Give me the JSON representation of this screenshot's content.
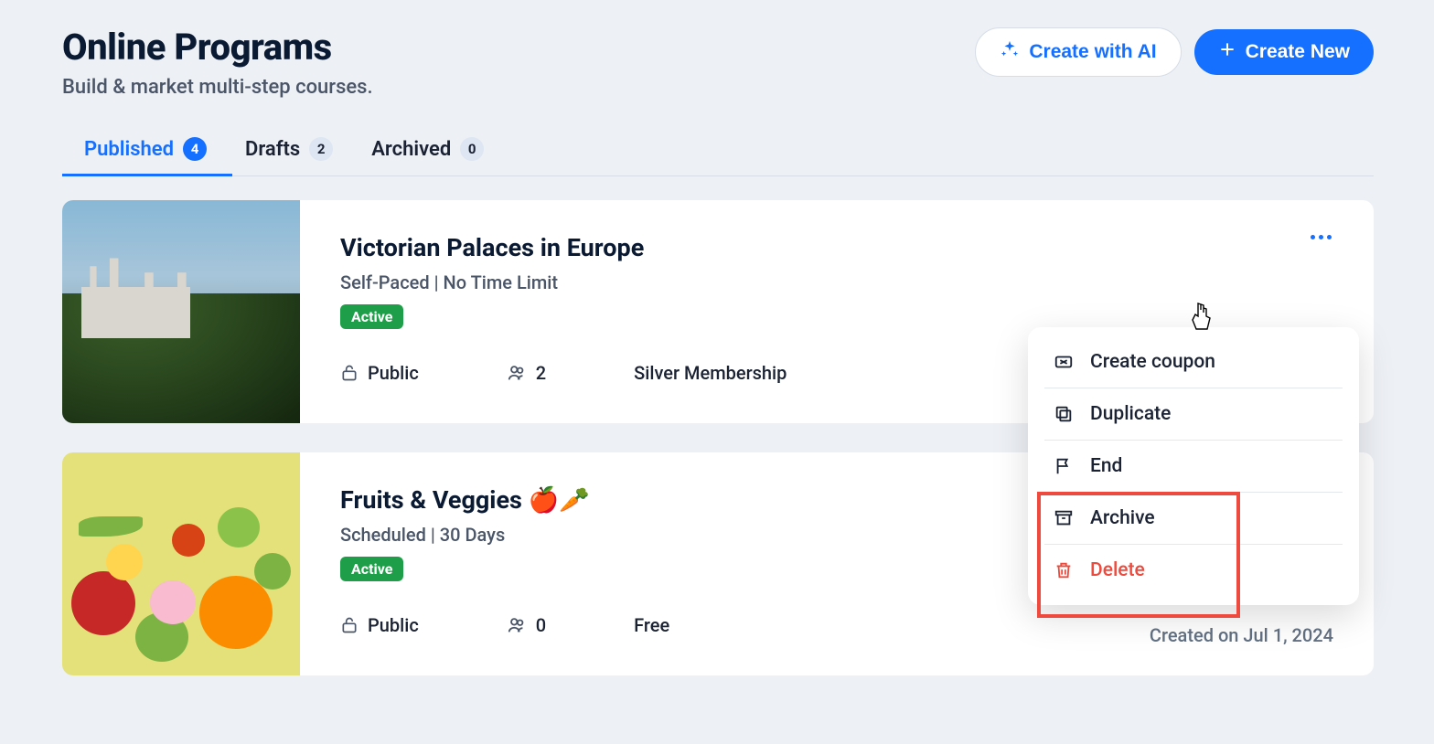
{
  "header": {
    "title": "Online Programs",
    "subtitle": "Build & market multi-step courses.",
    "create_ai_label": "Create with AI",
    "create_new_label": "Create New"
  },
  "tabs": [
    {
      "label": "Published",
      "count": "4",
      "active": true
    },
    {
      "label": "Drafts",
      "count": "2",
      "active": false
    },
    {
      "label": "Archived",
      "count": "0",
      "active": false
    }
  ],
  "cards": [
    {
      "title": "Victorian Palaces in Europe",
      "subtitle": "Self-Paced | No Time Limit",
      "status": "Active",
      "visibility": "Public",
      "members": "2",
      "plan": "Silver Membership",
      "created": ""
    },
    {
      "title": "Fruits & Veggies 🍎🥕",
      "subtitle": "Scheduled | 30 Days",
      "status": "Active",
      "visibility": "Public",
      "members": "0",
      "plan": "Free",
      "created": "Created on Jul 1, 2024"
    }
  ],
  "menu": {
    "create_coupon": "Create coupon",
    "duplicate": "Duplicate",
    "end": "End",
    "archive": "Archive",
    "delete": "Delete"
  }
}
